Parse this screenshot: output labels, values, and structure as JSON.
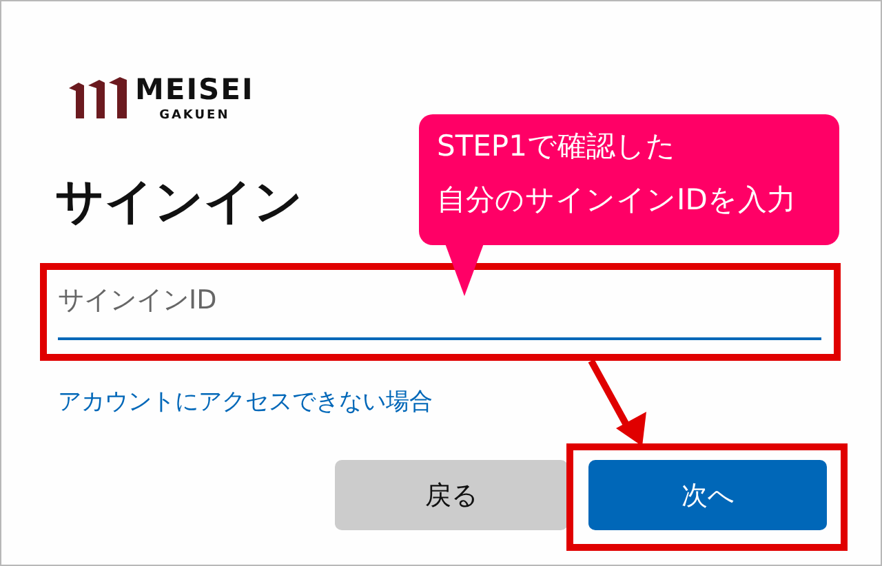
{
  "logo": {
    "name": "MEISEI",
    "subtitle": "GAKUEN"
  },
  "title": "サインイン",
  "signin_field": {
    "placeholder": "サインインID"
  },
  "help_link": "アカウントにアクセスできない場合",
  "buttons": [
    {
      "label": "戻る",
      "kind": "secondary"
    },
    {
      "label": "次へ",
      "kind": "primary"
    }
  ],
  "callout": {
    "lines": [
      "STEP1で確認した",
      "自分のサインインIDを入力"
    ]
  }
}
